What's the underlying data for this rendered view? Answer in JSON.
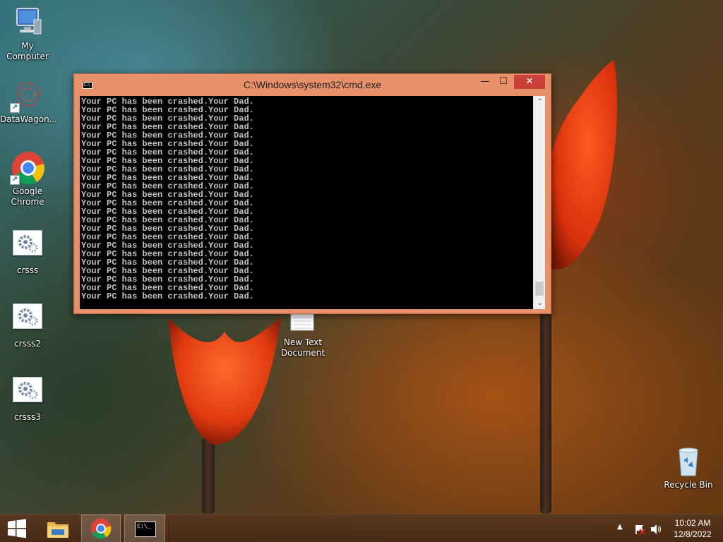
{
  "desktop": {
    "icons": [
      {
        "label": "My Computer"
      },
      {
        "label": "DataWagon..."
      },
      {
        "label": "Google Chrome"
      },
      {
        "label": "crsss"
      },
      {
        "label": "crsss2"
      },
      {
        "label": "crsss3"
      },
      {
        "label": "New Text Document"
      },
      {
        "label": "Recycle Bin"
      }
    ]
  },
  "cmd": {
    "title": "C:\\Windows\\system32\\cmd.exe",
    "minimize_label": "—",
    "maximize_label": "☐",
    "close_label": "✕",
    "output_lines": [
      "Your PC has been crashed.Your Dad.",
      "Your PC has been crashed.Your Dad.",
      "Your PC has been crashed.Your Dad.",
      "Your PC has been crashed.Your Dad.",
      "Your PC has been crashed.Your Dad.",
      "Your PC has been crashed.Your Dad.",
      "Your PC has been crashed.Your Dad.",
      "Your PC has been crashed.Your Dad.",
      "Your PC has been crashed.Your Dad.",
      "Your PC has been crashed.Your Dad.",
      "Your PC has been crashed.Your Dad.",
      "Your PC has been crashed.Your Dad.",
      "Your PC has been crashed.Your Dad.",
      "Your PC has been crashed.Your Dad.",
      "Your PC has been crashed.Your Dad.",
      "Your PC has been crashed.Your Dad.",
      "Your PC has been crashed.Your Dad.",
      "Your PC has been crashed.Your Dad.",
      "Your PC has been crashed.Your Dad.",
      "Your PC has been crashed.Your Dad.",
      "Your PC has been crashed.Your Dad.",
      "Your PC has been crashed.Your Dad.",
      "Your PC has been crashed.Your Dad.",
      "Your PC has been crashed.Your Dad."
    ]
  },
  "taskbar": {
    "start_icon": "windows-logo-icon",
    "pinned": [
      "file-explorer-icon",
      "chrome-icon",
      "cmd-icon"
    ],
    "tray": {
      "time": "10:02 AM",
      "date": "12/8/2022"
    }
  },
  "colors": {
    "cmd_frame": "#e8906a",
    "close_button": "#c7403a",
    "console_text": "#c0c0c0"
  }
}
